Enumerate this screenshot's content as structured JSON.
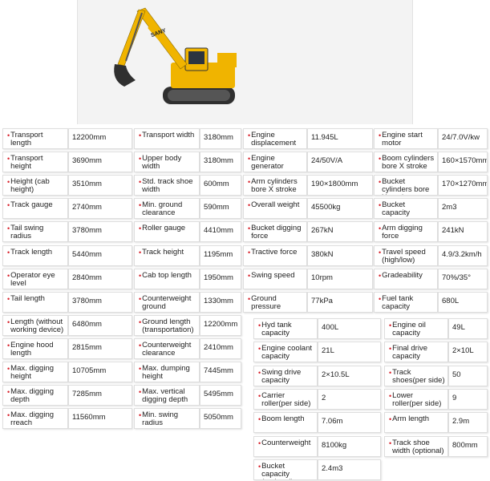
{
  "colors": {
    "bullet": "#d8202a",
    "excavator_body": "#f0b400",
    "track": "#333333"
  },
  "image": {
    "icon": "excavator-icon"
  },
  "brand_text": "SANY",
  "columns": [
    {
      "id": "c1",
      "rows": [
        {
          "label": "Transport length",
          "value": "12200mm"
        },
        {
          "label": "Transport height",
          "value": "3690mm"
        },
        {
          "label": "Height (cab height)",
          "value": "3510mm"
        },
        {
          "label": "Track gauge",
          "value": "2740mm"
        },
        {
          "label": "Tail swing radius",
          "value": "3780mm"
        },
        {
          "label": "Track length",
          "value": "5440mm"
        },
        {
          "label": "Operator eye level",
          "value": "2840mm"
        },
        {
          "label": "Tail length",
          "value": "3780mm"
        },
        {
          "label": "Length (without working device)",
          "value": "6480mm"
        },
        {
          "label": "Engine hood length",
          "value": "2815mm"
        },
        {
          "label": "Max. digging height",
          "value": "10705mm"
        },
        {
          "label": "Max. digging depth",
          "value": "7285mm"
        },
        {
          "label": "Max. digging rreach",
          "value": "11560mm"
        }
      ]
    },
    {
      "id": "c2",
      "rows": [
        {
          "label": "Transport width",
          "value": "3180mm"
        },
        {
          "label": "Upper body width",
          "value": "3180mm"
        },
        {
          "label": "Std. track shoe width",
          "value": "600mm"
        },
        {
          "label": "Min. ground clearance",
          "value": "590mm"
        },
        {
          "label": "Roller gauge",
          "value": "4410mm"
        },
        {
          "label": "Track height",
          "value": "1195mm"
        },
        {
          "label": "Cab top length",
          "value": "1950mm"
        },
        {
          "label": "Counterweight ground",
          "value": "1330mm"
        },
        {
          "label": "Ground length (transportation)",
          "value": "12200mm"
        },
        {
          "label": "Counterweight clearance",
          "value": "2410mm"
        },
        {
          "label": "Max. dumping height",
          "value": "7445mm"
        },
        {
          "label": "Max. vertical digging depth",
          "value": "5495mm"
        },
        {
          "label": "Min. swing radius",
          "value": "5050mm"
        }
      ]
    },
    {
      "id": "c3",
      "rows": [
        {
          "label": "Engine displacement",
          "value": "11.945L"
        },
        {
          "label": "Engine generator",
          "value": "24/50V/A"
        },
        {
          "label": "Arm cylinders bore X stroke",
          "value": "190×1800mm"
        },
        {
          "label": "Overall weight",
          "value": "45500kg"
        },
        {
          "label": "Bucket digging force",
          "value": "267kN"
        },
        {
          "label": "Tractive force",
          "value": "380kN"
        },
        {
          "label": "Swing speed",
          "value": "10rpm"
        },
        {
          "label": "Ground pressure",
          "value": "77kPa"
        }
      ]
    },
    {
      "id": "c4",
      "rows": [
        {
          "label": "Engine start motor",
          "value": "24/7.0V/kw"
        },
        {
          "label": "Boom cylinders bore X stroke",
          "value": "160×1570mm"
        },
        {
          "label": "Bucket cylinders bore X stroke",
          "value": "170×1270mm"
        },
        {
          "label": "Bucket capacity",
          "value": "2m3"
        },
        {
          "label": "Arm digging force",
          "value": "241kN"
        },
        {
          "label": "Travel speed (high/low)",
          "value": "4.9/3.2km/h"
        },
        {
          "label": "Gradeability",
          "value": "70%/35°"
        },
        {
          "label": "Fuel tank capacity",
          "value": "680L"
        }
      ]
    },
    {
      "id": "c5",
      "rows": [
        {
          "label": "Hyd tank capacity",
          "value": "400L"
        },
        {
          "label": "Engine coolant capacity",
          "value": "21L"
        },
        {
          "label": "Swing drive capacity",
          "value": "2×10.5L"
        },
        {
          "label": "Carrier roller(per side)",
          "value": "2"
        },
        {
          "label": "Boom length",
          "value": "7.06m"
        },
        {
          "label": "Counterweight",
          "value": "8100kg"
        },
        {
          "label": "Bucket capacity (optional)",
          "value": "2.4m3"
        }
      ]
    },
    {
      "id": "c6",
      "rows": [
        {
          "label": "Engine oil capacity",
          "value": "49L"
        },
        {
          "label": "Final drive capacity",
          "value": "2×10L"
        },
        {
          "label": "Track shoes(per side)",
          "value": "50"
        },
        {
          "label": "Lower roller(per side)",
          "value": "9"
        },
        {
          "label": "Arm length",
          "value": "2.9m"
        },
        {
          "label": "Track shoe width (optional)",
          "value": "800mm"
        }
      ]
    }
  ]
}
